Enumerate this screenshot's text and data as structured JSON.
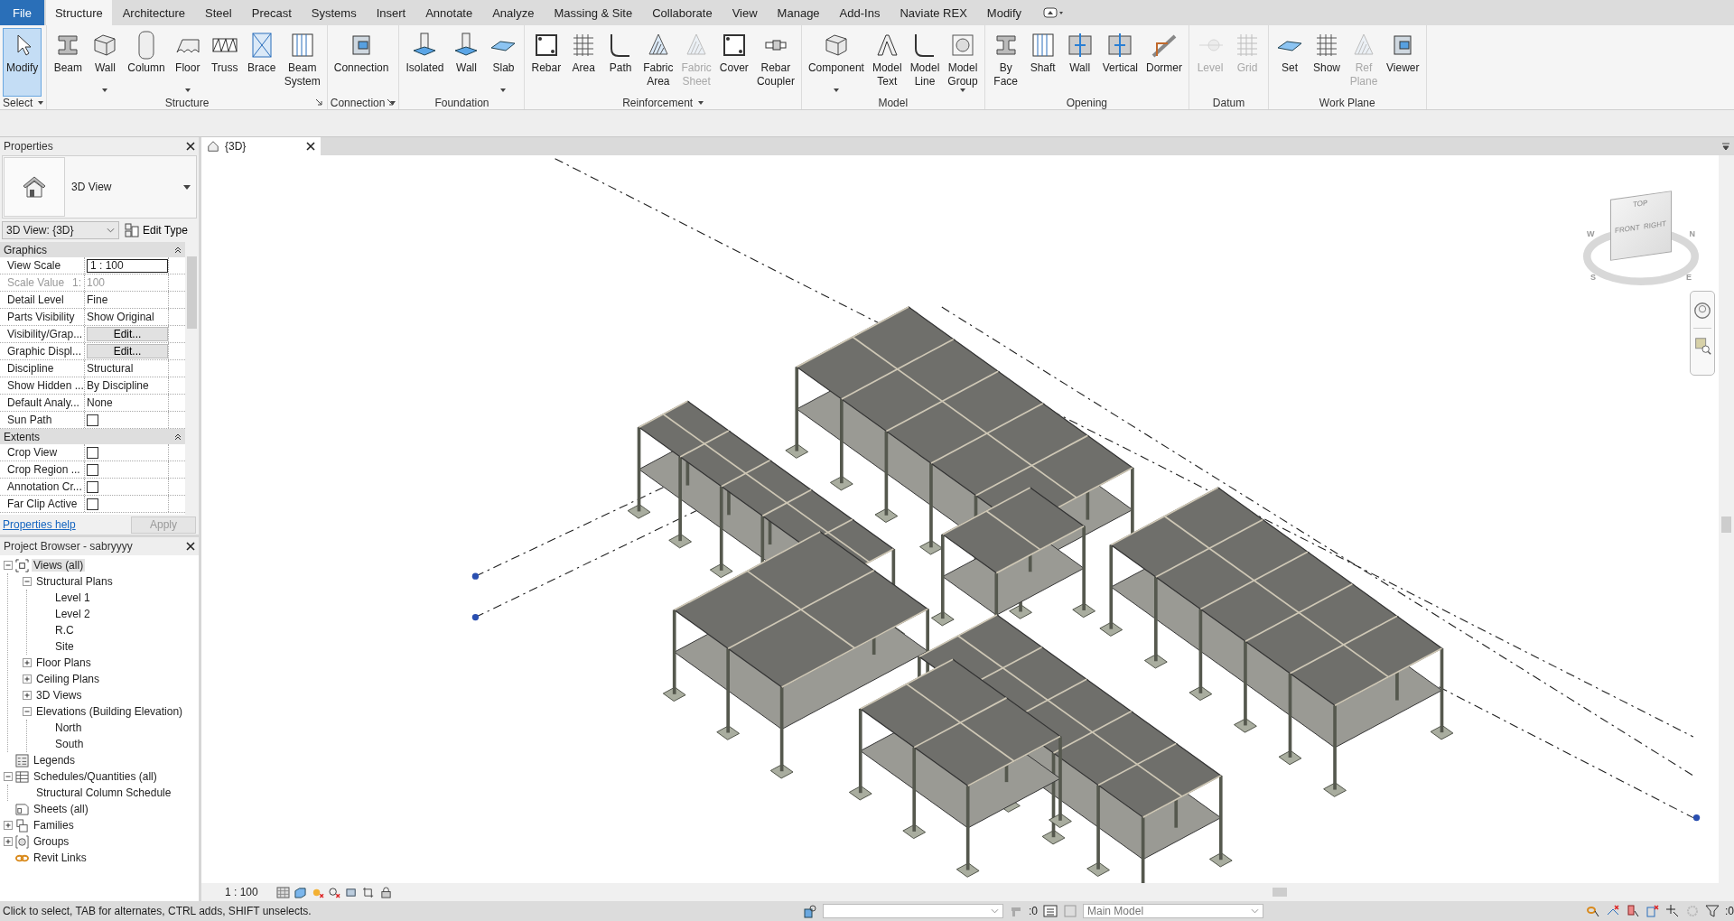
{
  "tabs": [
    {
      "label": "File",
      "kind": "file",
      "selected": false
    },
    {
      "label": "Structure",
      "kind": "tab",
      "selected": true
    },
    {
      "label": "Architecture",
      "kind": "tab",
      "selected": false
    },
    {
      "label": "Steel",
      "kind": "tab",
      "selected": false
    },
    {
      "label": "Precast",
      "kind": "tab",
      "selected": false
    },
    {
      "label": "Systems",
      "kind": "tab",
      "selected": false
    },
    {
      "label": "Insert",
      "kind": "tab",
      "selected": false
    },
    {
      "label": "Annotate",
      "kind": "tab",
      "selected": false
    },
    {
      "label": "Analyze",
      "kind": "tab",
      "selected": false
    },
    {
      "label": "Massing & Site",
      "kind": "tab",
      "selected": false
    },
    {
      "label": "Collaborate",
      "kind": "tab",
      "selected": false
    },
    {
      "label": "View",
      "kind": "tab",
      "selected": false
    },
    {
      "label": "Manage",
      "kind": "tab",
      "selected": false
    },
    {
      "label": "Add-Ins",
      "kind": "tab",
      "selected": false
    },
    {
      "label": "Naviate REX",
      "kind": "tab",
      "selected": false
    },
    {
      "label": "Modify",
      "kind": "tab",
      "selected": false
    }
  ],
  "ribbon": {
    "panels": [
      {
        "label": "Select",
        "menu": true,
        "tools": [
          {
            "label": "Modify",
            "selected": true,
            "disabled": false
          }
        ]
      },
      {
        "label": "Structure",
        "launcher": true,
        "tools": [
          {
            "label": "Beam",
            "selected": false,
            "disabled": false
          },
          {
            "label": "Wall",
            "selected": false,
            "disabled": false,
            "menu": true
          },
          {
            "label": "Column",
            "selected": false,
            "disabled": false
          },
          {
            "label": "Floor",
            "selected": false,
            "disabled": false,
            "menu": true
          },
          {
            "label": "Truss",
            "selected": false,
            "disabled": false
          },
          {
            "label": "Brace",
            "selected": false,
            "disabled": false
          },
          {
            "label": "Beam System",
            "selected": false,
            "disabled": false
          }
        ]
      },
      {
        "label": "Connection",
        "menu": true,
        "launcher": true,
        "tools": [
          {
            "label": "Connection",
            "selected": false,
            "disabled": false
          }
        ]
      },
      {
        "label": "Foundation",
        "tools": [
          {
            "label": "Isolated",
            "selected": false,
            "disabled": false
          },
          {
            "label": "Wall",
            "selected": false,
            "disabled": false
          },
          {
            "label": "Slab",
            "selected": false,
            "disabled": false,
            "menu": true
          }
        ]
      },
      {
        "label": "Reinforcement",
        "menu": true,
        "tools": [
          {
            "label": "Rebar",
            "selected": false,
            "disabled": false
          },
          {
            "label": "Area",
            "selected": false,
            "disabled": false
          },
          {
            "label": "Path",
            "selected": false,
            "disabled": false
          },
          {
            "label": "Fabric Area",
            "selected": false,
            "disabled": false
          },
          {
            "label": "Fabric Sheet",
            "selected": false,
            "disabled": true
          },
          {
            "label": "Cover",
            "selected": false,
            "disabled": false
          },
          {
            "label": "Rebar Coupler",
            "selected": false,
            "disabled": false
          }
        ]
      },
      {
        "label": "Model",
        "tools": [
          {
            "label": "Component",
            "selected": false,
            "disabled": false,
            "menu": true
          },
          {
            "label": "Model Text",
            "selected": false,
            "disabled": false
          },
          {
            "label": "Model Line",
            "selected": false,
            "disabled": false
          },
          {
            "label": "Model Group",
            "selected": false,
            "disabled": false,
            "menu": true
          }
        ]
      },
      {
        "label": "Opening",
        "tools": [
          {
            "label": "By Face",
            "selected": false,
            "disabled": false
          },
          {
            "label": "Shaft",
            "selected": false,
            "disabled": false
          },
          {
            "label": "Wall",
            "selected": false,
            "disabled": false
          },
          {
            "label": "Vertical",
            "selected": false,
            "disabled": false
          },
          {
            "label": "Dormer",
            "selected": false,
            "disabled": false
          }
        ]
      },
      {
        "label": "Datum",
        "tools": [
          {
            "label": "Level",
            "selected": false,
            "disabled": true
          },
          {
            "label": "Grid",
            "selected": false,
            "disabled": true
          }
        ]
      },
      {
        "label": "Work Plane",
        "tools": [
          {
            "label": "Set",
            "selected": false,
            "disabled": false
          },
          {
            "label": "Show",
            "selected": false,
            "disabled": false
          },
          {
            "label": "Ref Plane",
            "selected": false,
            "disabled": true
          },
          {
            "label": "Viewer",
            "selected": false,
            "disabled": false
          }
        ]
      }
    ]
  },
  "properties": {
    "title": "Properties",
    "type_name": "3D View",
    "type_selector": "3D View: {3D}",
    "edit_type": "Edit Type",
    "groups": [
      {
        "name": "Graphics",
        "expanded": true,
        "rows": [
          {
            "label": "View Scale",
            "kind": "field",
            "value": "1 : 100"
          },
          {
            "label": "Scale Value",
            "kind": "readonly",
            "prefix": "1:",
            "value": "100"
          },
          {
            "label": "Detail Level",
            "kind": "text",
            "value": "Fine"
          },
          {
            "label": "Parts Visibility",
            "kind": "text",
            "value": "Show Original"
          },
          {
            "label": "Visibility/Grap...",
            "kind": "button",
            "value": "Edit..."
          },
          {
            "label": "Graphic Displ...",
            "kind": "button",
            "value": "Edit..."
          },
          {
            "label": "Discipline",
            "kind": "text",
            "value": "Structural"
          },
          {
            "label": "Show Hidden ...",
            "kind": "text",
            "value": "By Discipline"
          },
          {
            "label": "Default Analy...",
            "kind": "text",
            "value": "None"
          },
          {
            "label": "Sun Path",
            "kind": "checkbox",
            "checked": false
          }
        ]
      },
      {
        "name": "Extents",
        "expanded": true,
        "rows": [
          {
            "label": "Crop View",
            "kind": "checkbox",
            "checked": false
          },
          {
            "label": "Crop Region ...",
            "kind": "checkbox",
            "checked": false
          },
          {
            "label": "Annotation Cr...",
            "kind": "checkbox",
            "checked": false
          },
          {
            "label": "Far Clip Active",
            "kind": "checkbox",
            "checked": false
          }
        ]
      }
    ],
    "help_link": "Properties help",
    "apply": {
      "label": "Apply",
      "disabled": true
    }
  },
  "browser": {
    "title": "Project Browser - sabryyyy",
    "tree": [
      {
        "label": "Views (all)",
        "kind": "views",
        "selected": true,
        "expanded": true,
        "children": [
          {
            "label": "Structural Plans",
            "selected": false,
            "expanded": true,
            "children": [
              {
                "label": "Level 1",
                "selected": false
              },
              {
                "label": "Level 2",
                "selected": false
              },
              {
                "label": "R.C",
                "selected": false
              },
              {
                "label": "Site",
                "selected": false
              }
            ]
          },
          {
            "label": "Floor Plans",
            "selected": false,
            "expanded": false
          },
          {
            "label": "Ceiling Plans",
            "selected": false,
            "expanded": false
          },
          {
            "label": "3D Views",
            "selected": false,
            "expanded": false
          },
          {
            "label": "Elevations (Building Elevation)",
            "selected": false,
            "expanded": true,
            "children": [
              {
                "label": "North",
                "selected": false
              },
              {
                "label": "South",
                "selected": false
              }
            ]
          }
        ]
      },
      {
        "label": "Legends",
        "kind": "legends",
        "selected": false
      },
      {
        "label": "Schedules/Quantities (all)",
        "kind": "schedules",
        "selected": false,
        "expanded": true,
        "children": [
          {
            "label": "Structural Column Schedule",
            "selected": false
          }
        ]
      },
      {
        "label": "Sheets (all)",
        "kind": "sheets",
        "selected": false
      },
      {
        "label": "Families",
        "kind": "families",
        "selected": false,
        "expanded": false
      },
      {
        "label": "Groups",
        "kind": "groups",
        "selected": false,
        "expanded": false
      },
      {
        "label": "Revit Links",
        "kind": "links",
        "selected": false
      }
    ]
  },
  "view": {
    "tab_label": "{3D}",
    "cube": {
      "top": "TOP",
      "front": "FRONT",
      "right": "RIGHT",
      "compass": [
        "W",
        "N",
        "S",
        "E"
      ]
    },
    "scale": "1 : 100"
  },
  "status_bar": {
    "message": "Click to select, TAB for alternates, CTRL adds, SHIFT unselects.",
    "editable_count": ":0",
    "design_option": "Main Model",
    "filter_count": ":0"
  }
}
